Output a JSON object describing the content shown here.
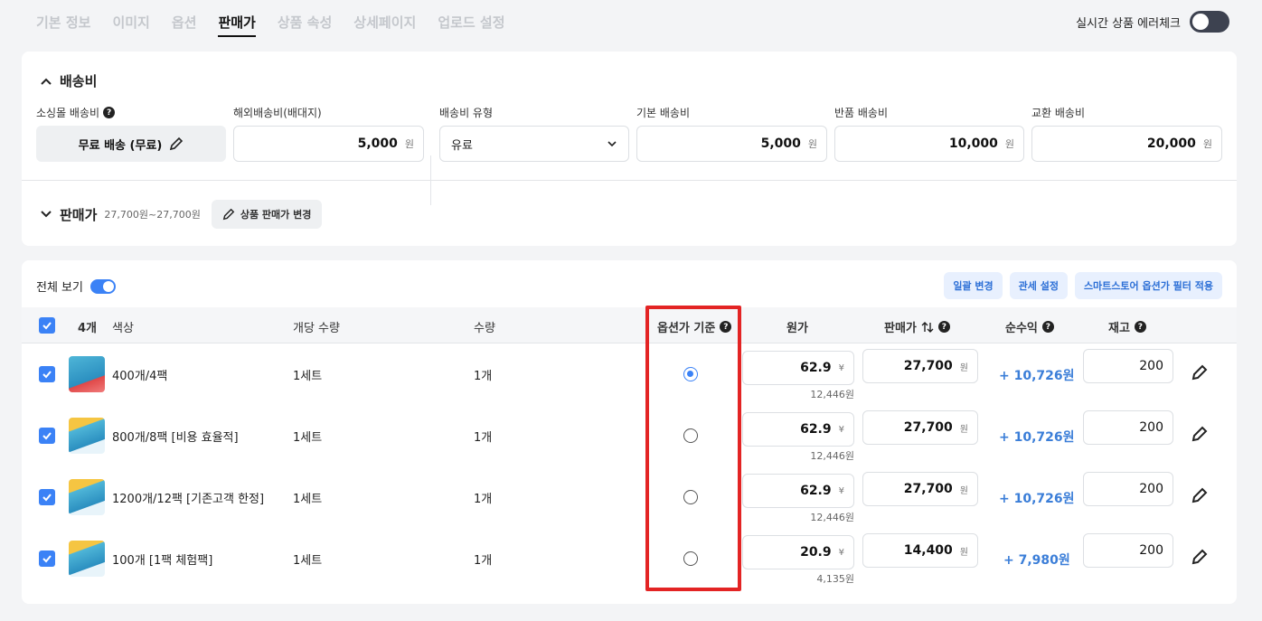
{
  "tabs": [
    "기본 정보",
    "이미지",
    "옵션",
    "판매가",
    "상품 속성",
    "상세페이지",
    "업로드 설정"
  ],
  "error_check_label": "실시간 상품 에러체크",
  "shipping": {
    "title": "배송비",
    "mall_label": "소싱몰 배송비",
    "mall_value": "무료 배송 (무료)",
    "overseas_label": "해외배송비(배대지)",
    "overseas_value": "5,000",
    "type_label": "배송비 유형",
    "type_value": "유료",
    "base_label": "기본 배송비",
    "base_value": "5,000",
    "return_label": "반품 배송비",
    "return_value": "10,000",
    "exchange_label": "교환 배송비",
    "exchange_value": "20,000",
    "unit": "원"
  },
  "price": {
    "title": "판매가",
    "range": "27,700원~27,700원",
    "change_button": "상품 판매가 변경"
  },
  "options": {
    "view_all": "전체 보기",
    "bulk_button": "일괄 변경",
    "tax_button": "관세 설정",
    "filter_button": "스마트스토어 옵션가 필터 적용",
    "headers": {
      "count": "4개",
      "color": "색상",
      "per_qty": "개당 수량",
      "qty": "수량",
      "base": "옵션가 기준",
      "cost": "원가",
      "sale": "판매가",
      "profit": "순수익",
      "stock": "재고"
    },
    "yen": "¥",
    "won": "원",
    "rows": [
      {
        "name": "400개/4팩",
        "per_qty": "1세트",
        "qty": "1개",
        "selected": true,
        "cost": "62.9",
        "cost_won": "12,446원",
        "sale": "27,700",
        "profit": "+ 10,726원",
        "stock": "200"
      },
      {
        "name": "800개/8팩 [비용 효율적]",
        "per_qty": "1세트",
        "qty": "1개",
        "selected": false,
        "cost": "62.9",
        "cost_won": "12,446원",
        "sale": "27,700",
        "profit": "+ 10,726원",
        "stock": "200"
      },
      {
        "name": "1200개/12팩 [기존고객 한정]",
        "per_qty": "1세트",
        "qty": "1개",
        "selected": false,
        "cost": "62.9",
        "cost_won": "12,446원",
        "sale": "27,700",
        "profit": "+ 10,726원",
        "stock": "200"
      },
      {
        "name": "100개 [1팩 체험팩]",
        "per_qty": "1세트",
        "qty": "1개",
        "selected": false,
        "cost": "20.9",
        "cost_won": "4,135원",
        "sale": "14,400",
        "profit": "+ 7,980원",
        "stock": "200"
      }
    ]
  },
  "colors": {
    "accent": "#3b82f6",
    "profit": "#3b7ed8",
    "highlight": "#e32424"
  }
}
